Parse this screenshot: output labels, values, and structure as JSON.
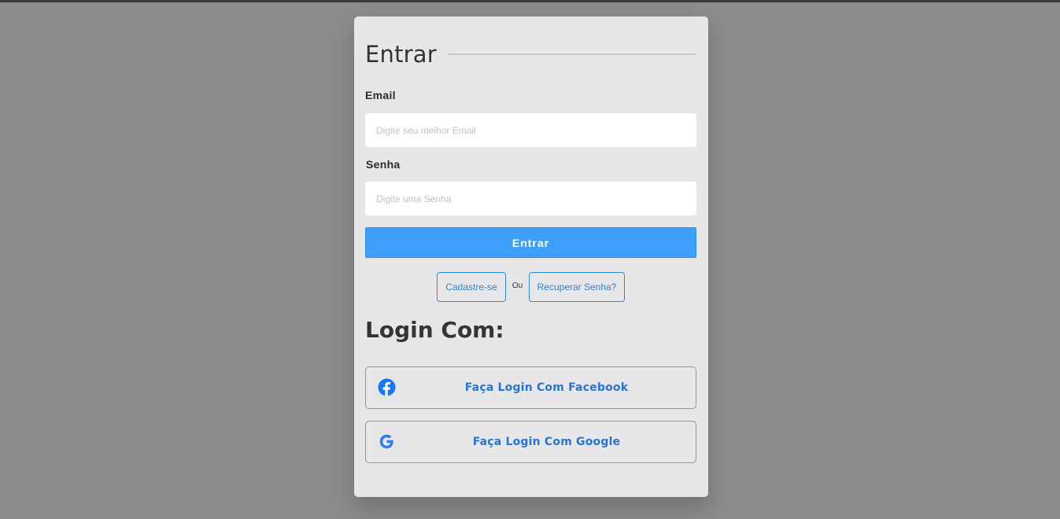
{
  "login_card": {
    "title": "Entrar",
    "email": {
      "label": "Email",
      "placeholder": "Digite seu melhor Email",
      "value": ""
    },
    "password": {
      "label": "Senha",
      "placeholder": "Digite uma Senha",
      "value": ""
    },
    "submit_label": "Entrar",
    "register_label": "Cadastre-se",
    "or_label": "Ou",
    "recover_label": "Recuperar Senha?",
    "social_heading": "Login Com:",
    "social_buttons": [
      {
        "label": "Faça Login Com Facebook",
        "icon": "facebook-icon"
      },
      {
        "label": "Faça Login Com Google",
        "icon": "google-icon"
      }
    ]
  },
  "colors": {
    "background": "#8b8a8c",
    "card": "#e7e6e8",
    "primary_button": "#3fa0fc",
    "link": "#2a86d6",
    "heading_text": "#343435"
  }
}
